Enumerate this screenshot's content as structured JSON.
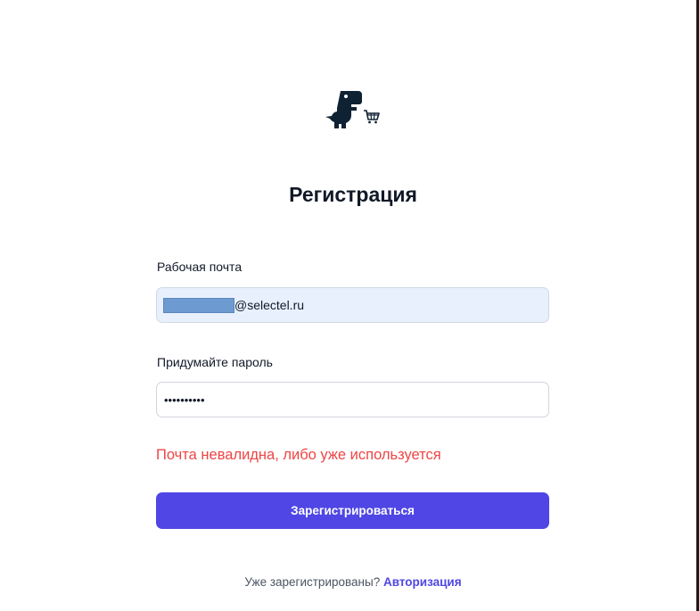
{
  "logo": {
    "icon": "dinosaur-cart-logo"
  },
  "title": "Регистрация",
  "email": {
    "label": "Рабочая почта",
    "domain_suffix": "@selectel.ru"
  },
  "password": {
    "label": "Придумайте пароль",
    "masked_value": "••••••••••"
  },
  "error_message": "Почта невалидна, либо уже используется",
  "submit_label": "Зарегистрироваться",
  "footer": {
    "prompt": "Уже зарегистрированы?",
    "link_label": "Авторизация"
  },
  "colors": {
    "primary": "#4f46e5",
    "error": "#ef4444",
    "autofill": "#e8f0fe"
  }
}
